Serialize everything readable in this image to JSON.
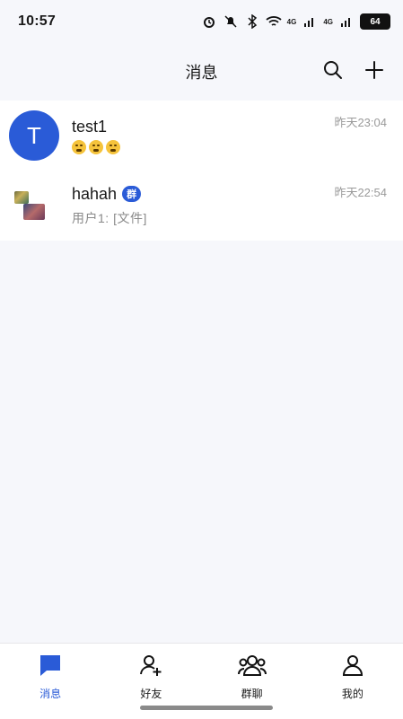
{
  "status_bar": {
    "time": "10:57",
    "network_a": "4G",
    "network_b": "4G",
    "battery": "64",
    "icons": [
      "alarm-icon",
      "mute-icon",
      "bluetooth-icon",
      "wifi-icon",
      "signal-icon",
      "signal-icon",
      "battery-icon"
    ]
  },
  "header": {
    "title": "消息",
    "icons": [
      "search-icon",
      "plus-icon"
    ]
  },
  "conversations": [
    {
      "name": "test1",
      "avatar_letter": "T",
      "avatar_color": "#2a5bd7",
      "preview": "😵😵😵",
      "time": "昨天23:04"
    },
    {
      "name": "hahah",
      "badge": "群",
      "preview": "用户1: [文件]",
      "time": "昨天22:54"
    }
  ],
  "tabbar": {
    "tabs": [
      {
        "label": "消息",
        "icon": "message-icon",
        "active": true
      },
      {
        "label": "好友",
        "icon": "add-friend-icon",
        "active": false
      },
      {
        "label": "群聊",
        "icon": "group-icon",
        "active": false
      },
      {
        "label": "我的",
        "icon": "profile-icon",
        "active": false
      }
    ]
  },
  "colors": {
    "accent": "#2a5bd7",
    "background": "#f6f7fb"
  }
}
